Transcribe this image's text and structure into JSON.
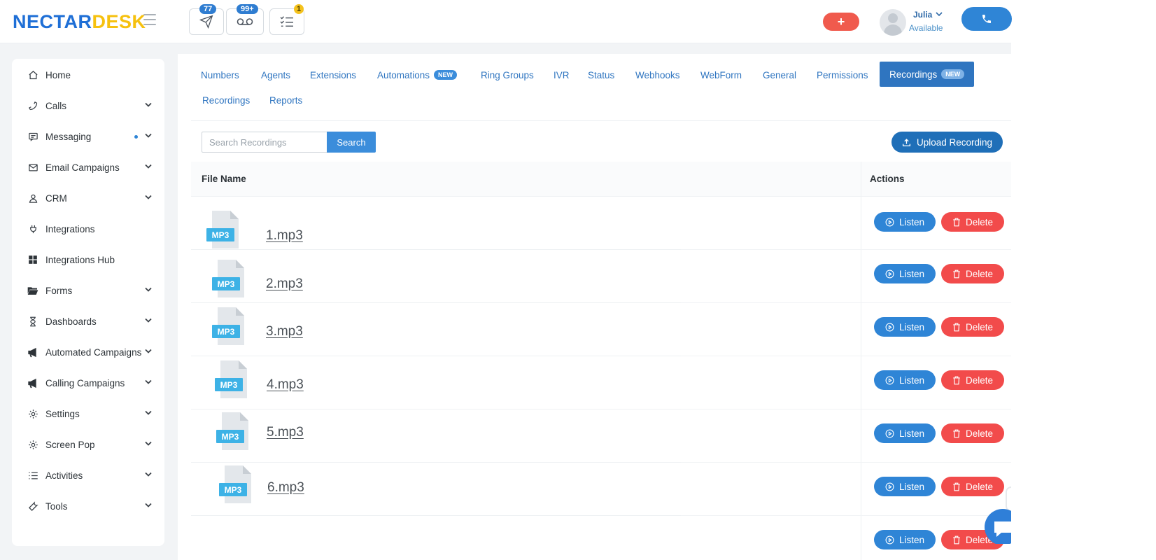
{
  "brand": {
    "logo_main": "NECTAR",
    "logo_accent": "DESK"
  },
  "topbar": {
    "icons": [
      {
        "name": "send-icon",
        "badge": "77"
      },
      {
        "name": "voicemail-icon",
        "badge": "99+"
      },
      {
        "name": "tasks-icon",
        "badge": "1"
      }
    ],
    "plus_label": "+",
    "user": {
      "name": "Julia",
      "status": "Available"
    }
  },
  "sidebar": {
    "items": [
      {
        "label": "Home",
        "icon": "home-icon",
        "chevron": false
      },
      {
        "label": "Calls",
        "icon": "phone-icon",
        "chevron": true
      },
      {
        "label": "Messaging",
        "icon": "message-icon",
        "chevron": true,
        "dot": true
      },
      {
        "label": "Email Campaigns",
        "icon": "mail-icon",
        "chevron": true
      },
      {
        "label": "CRM",
        "icon": "user-icon",
        "chevron": true
      },
      {
        "label": "Integrations",
        "icon": "plug-icon",
        "chevron": false
      },
      {
        "label": "Integrations Hub",
        "icon": "grid-icon",
        "chevron": false
      },
      {
        "label": "Forms",
        "icon": "folder-icon",
        "chevron": true
      },
      {
        "label": "Dashboards",
        "icon": "hourglass-icon",
        "chevron": true
      },
      {
        "label": "Automated Campaigns",
        "icon": "megaphone-icon",
        "chevron": true
      },
      {
        "label": "Calling Campaigns",
        "icon": "megaphone-icon",
        "chevron": true
      },
      {
        "label": "Settings",
        "icon": "gear-icon",
        "chevron": true
      },
      {
        "label": "Screen Pop",
        "icon": "gear-icon",
        "chevron": true
      },
      {
        "label": "Activities",
        "icon": "list-icon",
        "chevron": true
      },
      {
        "label": "Tools",
        "icon": "wrench-icon",
        "chevron": true
      }
    ]
  },
  "tabs": {
    "items": [
      {
        "label": "Numbers"
      },
      {
        "label": "Agents"
      },
      {
        "label": "Extensions"
      },
      {
        "label": "Automations",
        "pill": "NEW"
      },
      {
        "label": "Ring Groups"
      },
      {
        "label": "IVR"
      },
      {
        "label": "Status"
      },
      {
        "label": "Webhooks"
      },
      {
        "label": "WebForm"
      },
      {
        "label": "General"
      },
      {
        "label": "Permissions"
      },
      {
        "label": "Recordings",
        "pill": "NEW",
        "active": true
      },
      {
        "label": "Recordings"
      },
      {
        "label": "Reports"
      }
    ]
  },
  "toolbar": {
    "search_placeholder": "Search Recordings",
    "search_label": "Search",
    "upload_label": "Upload Recording"
  },
  "table": {
    "headers": {
      "file_name": "File Name",
      "actions": "Actions"
    },
    "file_icon_label": "MP3",
    "listen_label": "Listen",
    "delete_label": "Delete",
    "rows": [
      {
        "name": "1.mp3"
      },
      {
        "name": "2.mp3"
      },
      {
        "name": "3.mp3"
      },
      {
        "name": "4.mp3"
      },
      {
        "name": "5.mp3"
      },
      {
        "name": "6.mp3"
      },
      {
        "name": ""
      }
    ]
  },
  "colors": {
    "primary": "#2f85d6",
    "active_tab": "#2f75c0",
    "danger": "#f24b4b",
    "plus": "#f05a4d",
    "upload": "#1f6fb8"
  }
}
